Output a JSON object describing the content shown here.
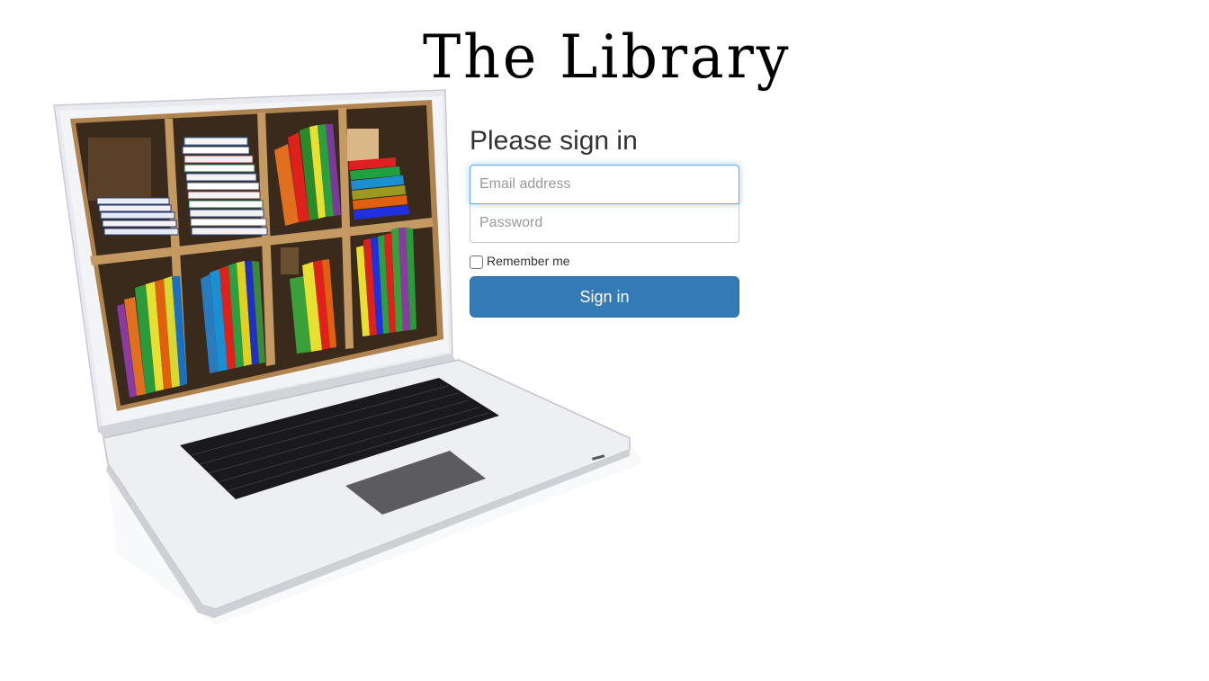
{
  "header": {
    "title": "The Library"
  },
  "illustration": {
    "icon": "laptop-bookshelf-image"
  },
  "signin": {
    "heading": "Please sign in",
    "email_placeholder": "Email address",
    "email_value": "",
    "password_placeholder": "Password",
    "password_value": "",
    "remember_label": "Remember me",
    "remember_checked": false,
    "button_label": "Sign in"
  },
  "colors": {
    "button_bg": "#337ab7",
    "focus_border": "#66afe9"
  }
}
